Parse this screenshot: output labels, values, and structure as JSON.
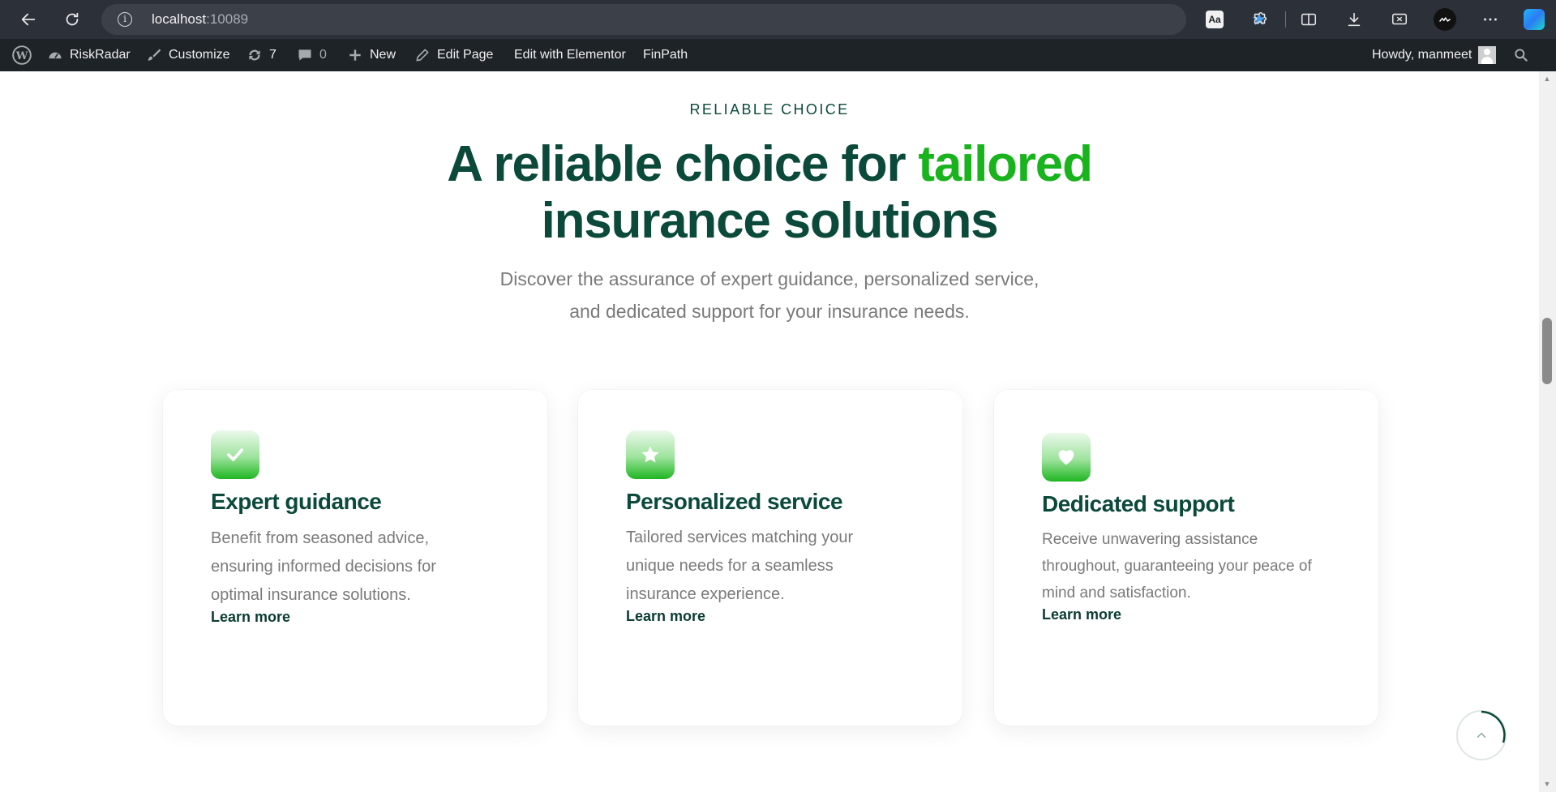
{
  "browser": {
    "url_host": "localhost",
    "url_port": ":10089",
    "read_aloud_label": "A̅",
    "aa_label": "Aa"
  },
  "admin_bar": {
    "site_name": "RiskRadar",
    "customize": "Customize",
    "updates_count": "7",
    "comments_count": "0",
    "new": "New",
    "edit_page": "Edit Page",
    "edit_elementor": "Edit with Elementor",
    "finpath": "FinPath",
    "howdy": "Howdy, manmeet"
  },
  "section": {
    "eyebrow": "RELIABLE CHOICE",
    "headline_part1": "A reliable choice for ",
    "headline_accent": "tailored",
    "headline_part2": "insurance solutions",
    "subtitle": "Discover the assurance of expert guidance, personalized service, and dedicated support for your insurance needs."
  },
  "cards": [
    {
      "icon": "check-icon",
      "title": "Expert guidance",
      "text": "Benefit from seasoned advice, ensuring informed decisions for optimal insurance solutions.",
      "link": "Learn more"
    },
    {
      "icon": "star-icon",
      "title": "Personalized service",
      "text": "Tailored services matching your unique needs for a seamless insurance experience.",
      "link": "Learn more"
    },
    {
      "icon": "heart-icon",
      "title": "Dedicated support",
      "text": "Receive unwavering assistance throughout, guaranteeing your peace of mind and satisfaction.",
      "link": "Learn more"
    }
  ],
  "colors": {
    "dark_green": "#0b4a3a",
    "accent_green": "#19b31d",
    "body_gray": "#7a7a7a",
    "admin_bar_bg": "#1d2327",
    "browser_bg": "#2b3039"
  }
}
